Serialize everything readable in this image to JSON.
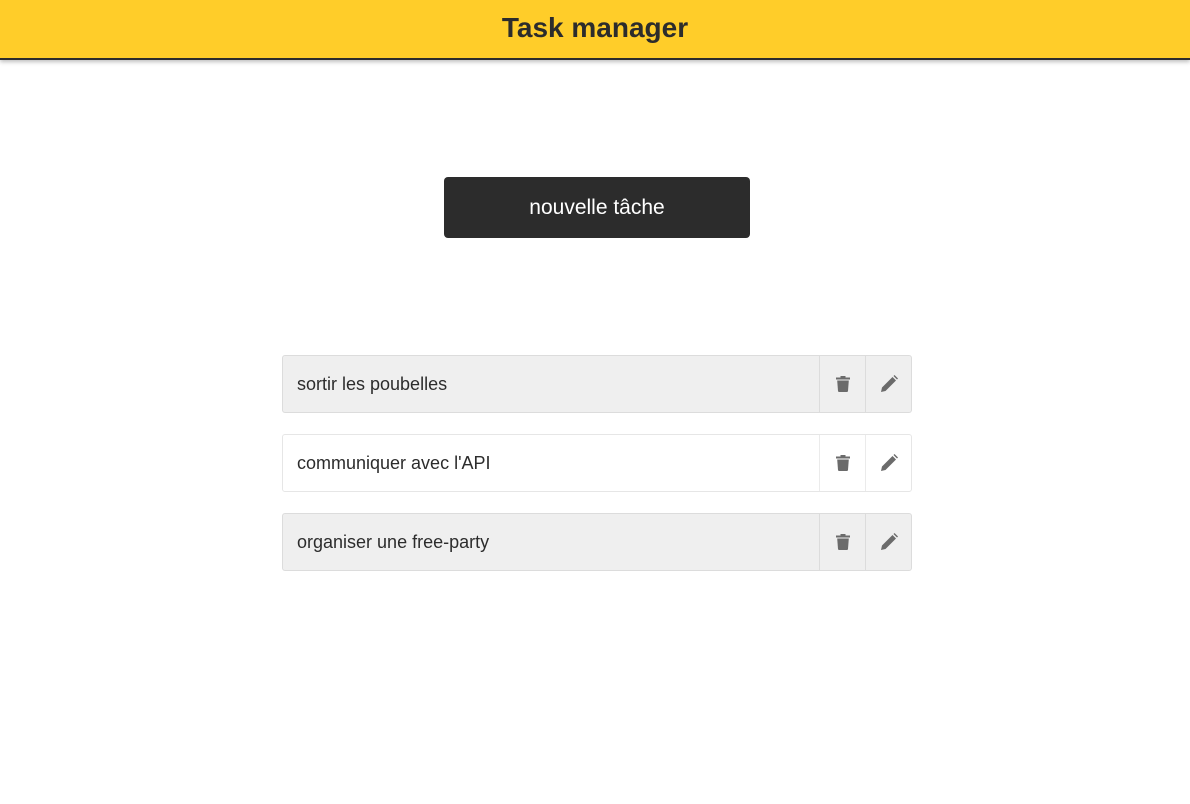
{
  "header": {
    "title": "Task manager"
  },
  "main": {
    "new_task_label": "nouvelle tâche"
  },
  "tasks": [
    {
      "label": "sortir les poubelles",
      "delete_icon": "trash-icon",
      "edit_icon": "pencil-icon"
    },
    {
      "label": "communiquer avec l'API",
      "delete_icon": "trash-icon",
      "edit_icon": "pencil-icon"
    },
    {
      "label": "organiser une free-party",
      "delete_icon": "trash-icon",
      "edit_icon": "pencil-icon"
    }
  ],
  "colors": {
    "header_bg": "#ffcd29",
    "button_bg": "#2c2c2c",
    "icon": "#6b6b6b"
  }
}
